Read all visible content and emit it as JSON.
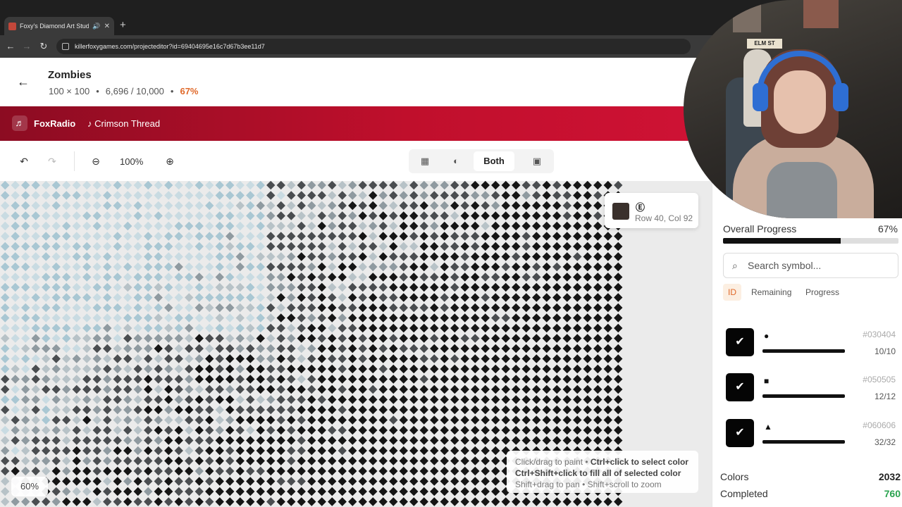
{
  "browser": {
    "tab_title": "Foxy's Diamond Art Studio",
    "new_tab_label": "+",
    "url": "killerfoxygames.com/projecteditor?id=69404695e16c7d67b3ee11d7"
  },
  "header": {
    "back_label": "←",
    "title": "Zombies",
    "dimensions": "100 × 100",
    "separator": "•",
    "placed": "6,696 / 10,000",
    "percent": "67%"
  },
  "radio": {
    "icon": "♬",
    "brand": "FoxRadio",
    "track": "♪ Crimson Thread"
  },
  "toolbar": {
    "undo_icon": "↶",
    "redo_icon": "↷",
    "zoom_out_icon": "⊖",
    "zoom_level": "100%",
    "zoom_in_icon": "⊕",
    "view_grid_icon": "▦",
    "view_palette_icon": "◐",
    "view_both_label": "Both",
    "view_image_icon": "▣"
  },
  "canvas": {
    "cell_tooltip": {
      "symbol": "Ⓔ",
      "position": "Row 40, Col 92",
      "swatch_color": "#3a302c"
    },
    "zoom_badge": "60%",
    "hints": {
      "line1_a": "Click/drag to paint • ",
      "line1_b": "Ctrl+click to select color",
      "line2": "Ctrl+Shift+click to fill all of selected color",
      "line3": "Shift+drag to pan • Shift+scroll to zoom"
    }
  },
  "panel": {
    "collapse_icon": "⌃",
    "overall_label": "Overall Progress",
    "overall_percent": "67%",
    "overall_fraction": 0.67,
    "search_placeholder": "Search symbol...",
    "sort_tabs": [
      "ID",
      "Remaining",
      "Progress"
    ],
    "colors": [
      {
        "symbol": "●",
        "hex": "#030404",
        "count": "10/10",
        "check": "✔"
      },
      {
        "symbol": "■",
        "hex": "#050505",
        "count": "12/12",
        "check": "✔"
      },
      {
        "symbol": "▲",
        "hex": "#060606",
        "count": "32/32",
        "check": "✔"
      }
    ],
    "stats": {
      "colors_label": "Colors",
      "colors_value": "2032",
      "completed_label": "Completed",
      "completed_value": "760"
    }
  },
  "webcam": {
    "sign_text": "ELM ST"
  },
  "colors": {
    "accent": "#e0692a",
    "radio_start": "#8c0c22",
    "radio_end": "#d8143a",
    "success": "#2aa34f"
  }
}
